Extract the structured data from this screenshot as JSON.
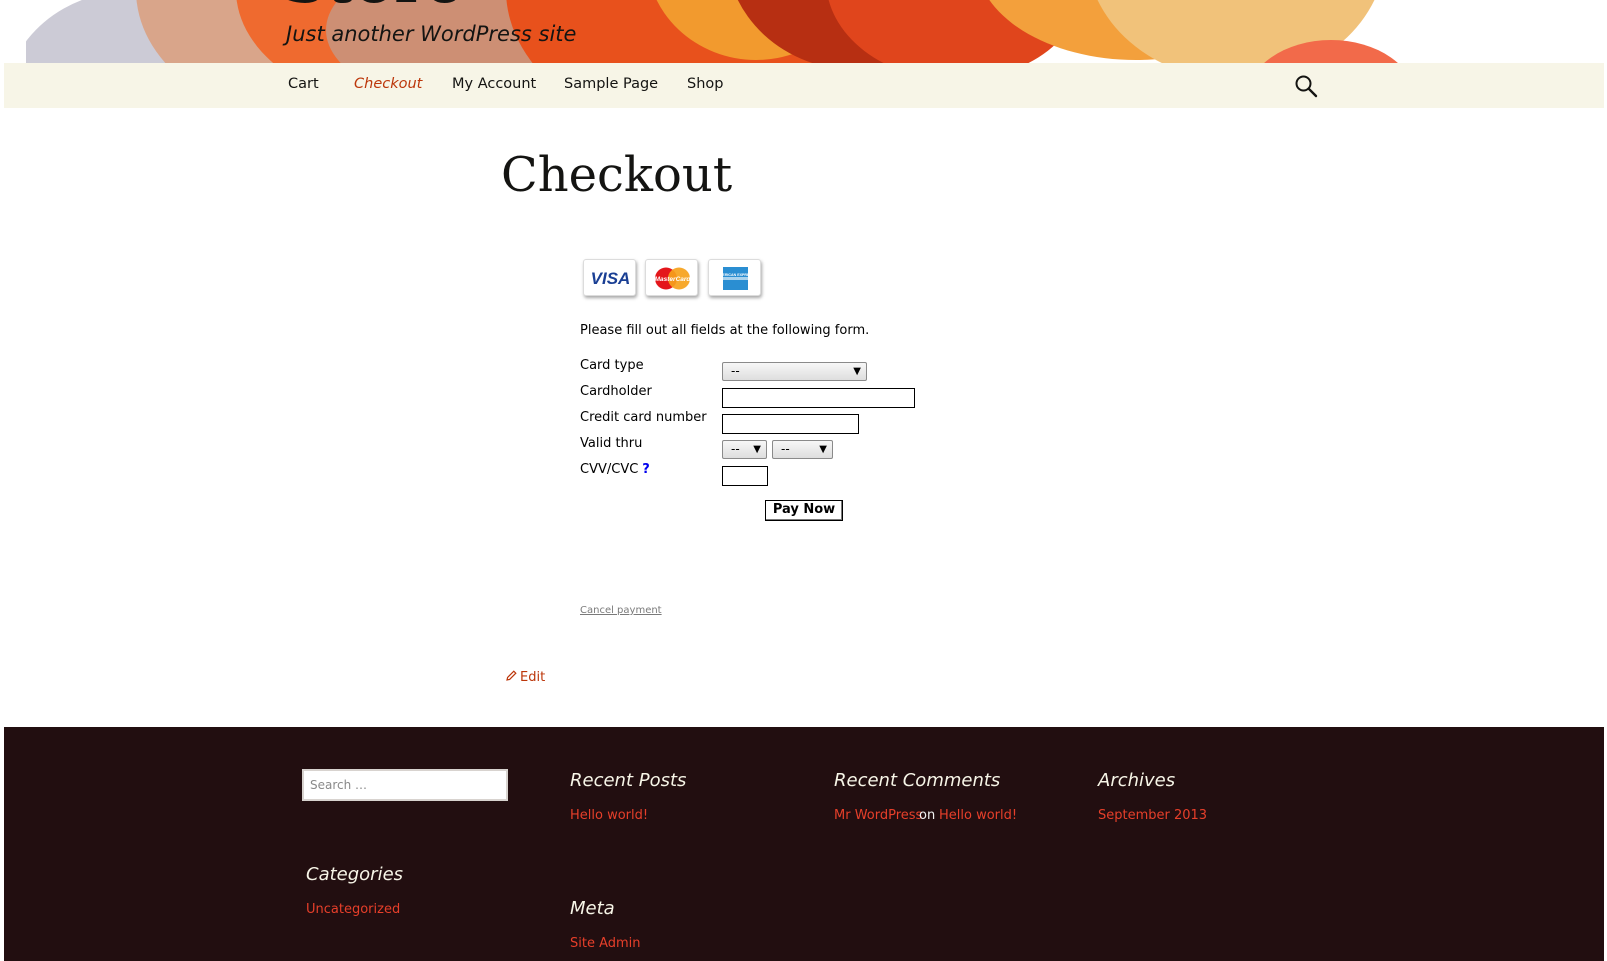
{
  "header": {
    "site_title": "Store",
    "site_description": "Just another WordPress site"
  },
  "nav": {
    "items": [
      {
        "label": "Cart",
        "active": false
      },
      {
        "label": "Checkout",
        "active": true
      },
      {
        "label": "My Account",
        "active": false
      },
      {
        "label": "Sample Page",
        "active": false
      },
      {
        "label": "Shop",
        "active": false
      }
    ],
    "search_icon": "search-icon"
  },
  "main": {
    "title": "Checkout",
    "cards": [
      {
        "name": "visa-card-icon",
        "label": "VISA"
      },
      {
        "name": "mastercard-card-icon",
        "label": "MasterCard"
      },
      {
        "name": "amex-card-icon",
        "label": "AMERICAN EXPRESS"
      }
    ],
    "form": {
      "intro": "Please fill out all fields at the following form.",
      "card_type": {
        "label": "Card type",
        "value": "--"
      },
      "cardholder": {
        "label": "Cardholder",
        "value": ""
      },
      "card_number": {
        "label": "Credit card number",
        "value": ""
      },
      "valid_thru": {
        "label": "Valid thru",
        "month": "--",
        "year": "--"
      },
      "cvv": {
        "label": "CVV/CVC",
        "help": "?",
        "value": ""
      },
      "submit": "Pay Now"
    },
    "cancel": "Cancel payment",
    "edit": "Edit"
  },
  "footer": {
    "search_placeholder": "Search …",
    "recent_posts": {
      "title": "Recent Posts",
      "items": [
        "Hello world!"
      ]
    },
    "recent_comments": {
      "title": "Recent Comments",
      "author": "Mr WordPress",
      "on": "on",
      "post": "Hello world!"
    },
    "archives": {
      "title": "Archives",
      "items": [
        "September 2013"
      ]
    },
    "categories": {
      "title": "Categories",
      "items": [
        "Uncategorized"
      ]
    },
    "meta": {
      "title": "Meta",
      "items": [
        "Site Admin"
      ]
    }
  },
  "colors": {
    "accent": "#bc360a",
    "nav_bg": "#f7f5e7",
    "footer_bg": "#220e10",
    "footer_link": "#e63f2a"
  }
}
